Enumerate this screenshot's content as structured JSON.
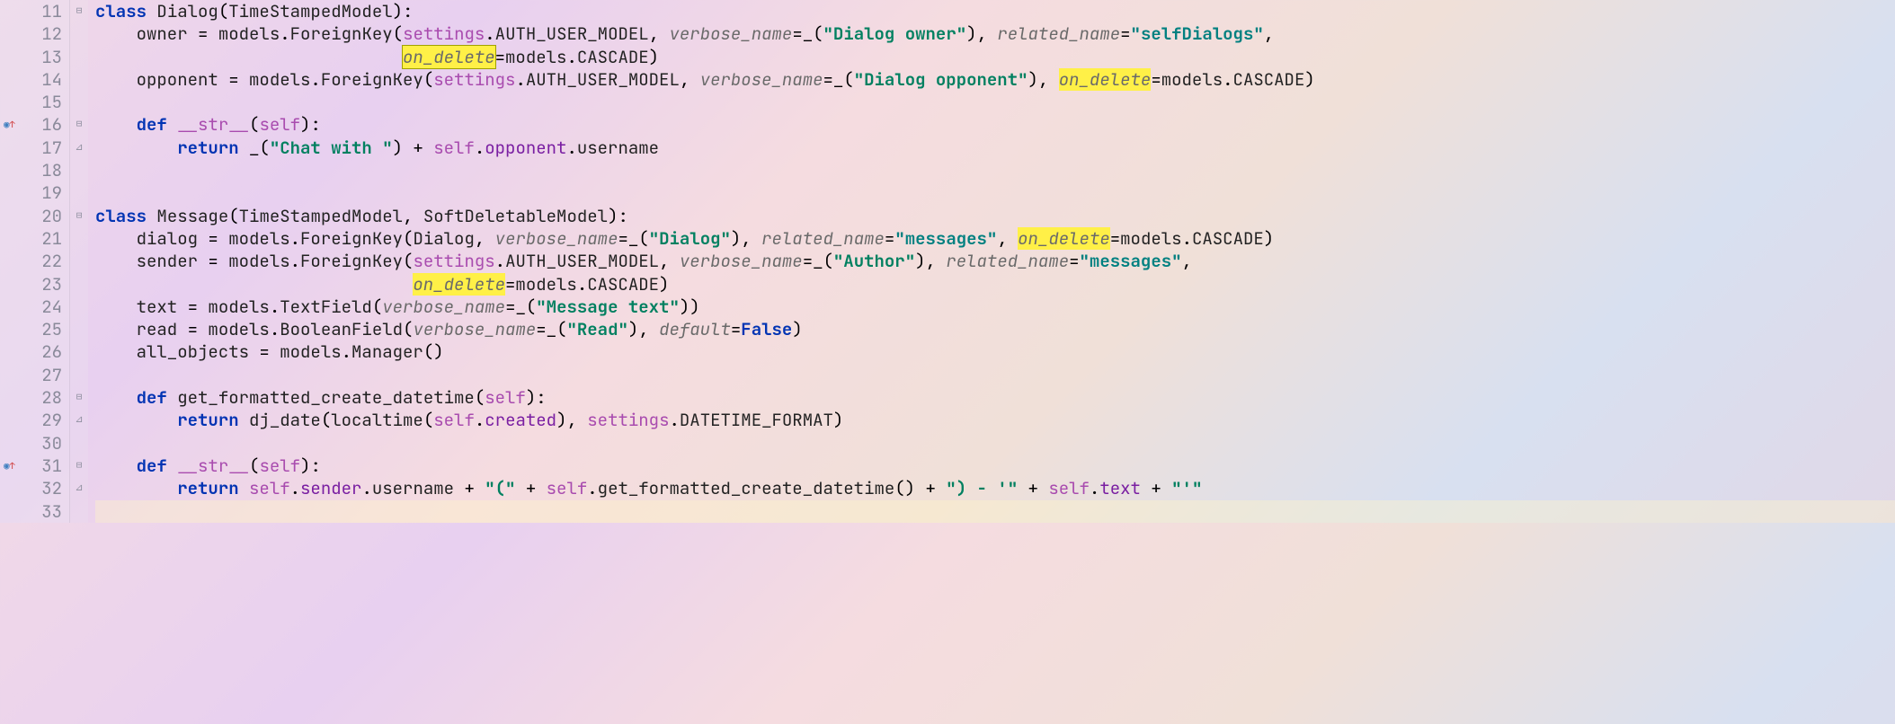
{
  "lines": [
    {
      "num": "11"
    },
    {
      "num": "12"
    },
    {
      "num": "13"
    },
    {
      "num": "14"
    },
    {
      "num": "15"
    },
    {
      "num": "16",
      "marker": true
    },
    {
      "num": "17"
    },
    {
      "num": "18"
    },
    {
      "num": "19"
    },
    {
      "num": "20"
    },
    {
      "num": "21"
    },
    {
      "num": "22"
    },
    {
      "num": "23"
    },
    {
      "num": "24"
    },
    {
      "num": "25"
    },
    {
      "num": "26"
    },
    {
      "num": "27"
    },
    {
      "num": "28"
    },
    {
      "num": "29"
    },
    {
      "num": "30"
    },
    {
      "num": "31",
      "marker": true
    },
    {
      "num": "32"
    },
    {
      "num": "33"
    }
  ],
  "code": {
    "l11": {
      "kw_class": "class",
      "name": "Dialog",
      "base": "TimeStampedModel"
    },
    "l12": {
      "field": "owner",
      "mod": "models",
      "fk": "ForeignKey",
      "settings": "settings",
      "auth": "AUTH_USER_MODEL",
      "vn": "verbose_name",
      "vn_val": "\"Dialog owner\"",
      "rn": "related_name",
      "rn_val": "\"selfDialogs\""
    },
    "l13": {
      "od": "on_delete",
      "mod": "models",
      "casc": "CASCADE"
    },
    "l14": {
      "field": "opponent",
      "mod": "models",
      "fk": "ForeignKey",
      "settings": "settings",
      "auth": "AUTH_USER_MODEL",
      "vn": "verbose_name",
      "vn_val": "\"Dialog opponent\"",
      "od": "on_delete",
      "mod2": "models",
      "casc": "CASCADE"
    },
    "l16": {
      "kw_def": "def",
      "name": "__str__",
      "self": "self"
    },
    "l17": {
      "kw_ret": "return",
      "str": "\"Chat with \"",
      "self": "self",
      "opp": "opponent",
      "un": "username"
    },
    "l20": {
      "kw_class": "class",
      "name": "Message",
      "b1": "TimeStampedModel",
      "b2": "SoftDeletableModel"
    },
    "l21": {
      "field": "dialog",
      "mod": "models",
      "fk": "ForeignKey",
      "dlg": "Dialog",
      "vn": "verbose_name",
      "vn_val": "\"Dialog\"",
      "rn": "related_name",
      "rn_val": "\"messages\"",
      "od": "on_delete",
      "mod2": "models",
      "casc": "CASCADE"
    },
    "l22": {
      "field": "sender",
      "mod": "models",
      "fk": "ForeignKey",
      "settings": "settings",
      "auth": "AUTH_USER_MODEL",
      "vn": "verbose_name",
      "vn_val": "\"Author\"",
      "rn": "related_name",
      "rn_val": "\"messages\""
    },
    "l23": {
      "od": "on_delete",
      "mod": "models",
      "casc": "CASCADE"
    },
    "l24": {
      "field": "text",
      "mod": "models",
      "tf": "TextField",
      "vn": "verbose_name",
      "vn_val": "\"Message text\""
    },
    "l25": {
      "field": "read",
      "mod": "models",
      "bf": "BooleanField",
      "vn": "verbose_name",
      "vn_val": "\"Read\"",
      "def": "default",
      "false": "False"
    },
    "l26": {
      "field": "all_objects",
      "mod": "models",
      "mgr": "Manager"
    },
    "l28": {
      "kw_def": "def",
      "name": "get_formatted_create_datetime",
      "self": "self"
    },
    "l29": {
      "kw_ret": "return",
      "dj": "dj_date",
      "lt": "localtime",
      "self": "self",
      "cr": "created",
      "settings": "settings",
      "fmt": "DATETIME_FORMAT"
    },
    "l31": {
      "kw_def": "def",
      "name": "__str__",
      "self": "self"
    },
    "l32": {
      "kw_ret": "return",
      "self": "self",
      "sender": "sender",
      "un": "username",
      "s1": "\"(\"",
      "self2": "self",
      "gfcd": "get_formatted_create_datetime",
      "s2": "\") - '\"",
      "self3": "self",
      "text": "text",
      "s3": "\"'\""
    }
  }
}
